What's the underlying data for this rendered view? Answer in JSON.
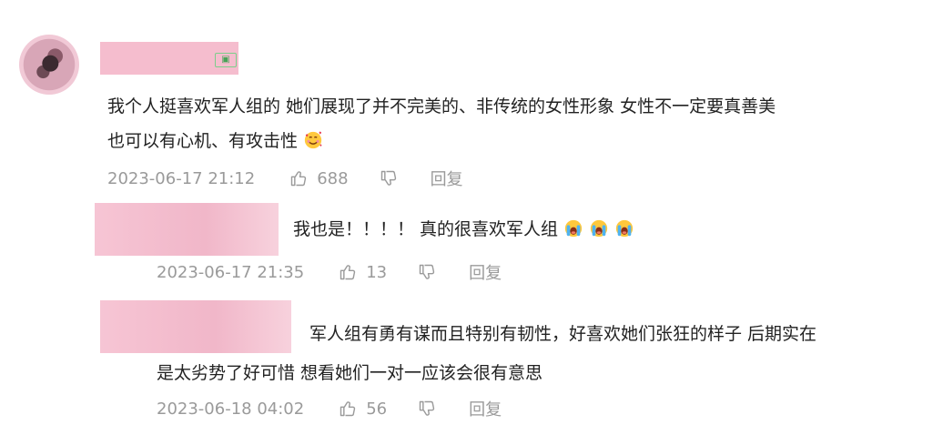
{
  "comments": [
    {
      "text_line1": "我个人挺喜欢军人组的 她们展现了并不完美的、非传统的女性形象 女性不一定要真善美",
      "text_line2": "也可以有心机、有攻击性",
      "emoji": "smiling-face-with-hearts-icon",
      "time": "2023-06-17 21:12",
      "likes": "688",
      "reply_label": "回复"
    }
  ],
  "replies": [
    {
      "text": "我也是！！！！ 真的很喜欢军人组",
      "emoji": "loudly-crying-face-icon",
      "time": "2023-06-17 21:35",
      "likes": "13",
      "reply_label": "回复"
    },
    {
      "text_line1": "军人组有勇有谋而且特别有韧性，好喜欢她们张狂的样子 后期实在",
      "text_line2": "是太劣势了好可惜 想看她们一对一应该会很有意思",
      "time": "2023-06-18 04:02",
      "likes": "56",
      "reply_label": "回复"
    }
  ],
  "colors": {
    "text": "#222222",
    "meta": "#9a9a9a",
    "mask": "#f4b9cb",
    "badge": "#46a357"
  }
}
